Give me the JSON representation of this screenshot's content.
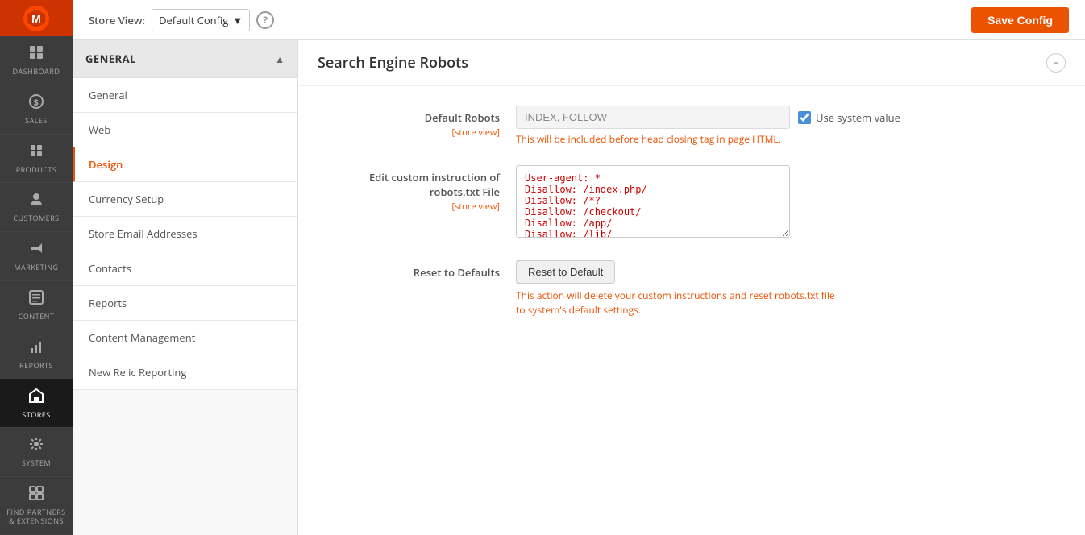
{
  "sidebar": {
    "logo_text": "M",
    "items": [
      {
        "id": "dashboard",
        "label": "DASHBOARD",
        "icon": "⊞"
      },
      {
        "id": "sales",
        "label": "SALES",
        "icon": "$"
      },
      {
        "id": "products",
        "label": "PRODUCTS",
        "icon": "◈"
      },
      {
        "id": "customers",
        "label": "CUSTOMERS",
        "icon": "👤"
      },
      {
        "id": "marketing",
        "label": "MARKETING",
        "icon": "📢"
      },
      {
        "id": "content",
        "label": "CONTENT",
        "icon": "▣"
      },
      {
        "id": "reports",
        "label": "REPORTS",
        "icon": "📊"
      },
      {
        "id": "stores",
        "label": "STORES",
        "icon": "🏪",
        "active": true
      },
      {
        "id": "system",
        "label": "SYSTEM",
        "icon": "⚙"
      },
      {
        "id": "find",
        "label": "FIND PARTNERS & EXTENSIONS",
        "icon": "🧩"
      }
    ]
  },
  "topbar": {
    "store_view_label": "Store View:",
    "store_view_value": "Default Config",
    "help_icon": "?",
    "save_button": "Save Config"
  },
  "left_nav": {
    "section_title": "GENERAL",
    "items": [
      {
        "id": "general",
        "label": "General",
        "active": false
      },
      {
        "id": "web",
        "label": "Web",
        "active": false
      },
      {
        "id": "design",
        "label": "Design",
        "active": true
      },
      {
        "id": "currency-setup",
        "label": "Currency Setup",
        "active": false
      },
      {
        "id": "store-email",
        "label": "Store Email Addresses",
        "active": false
      },
      {
        "id": "contacts",
        "label": "Contacts",
        "active": false
      },
      {
        "id": "reports",
        "label": "Reports",
        "active": false
      },
      {
        "id": "content-management",
        "label": "Content Management",
        "active": false
      },
      {
        "id": "new-relic",
        "label": "New Relic Reporting",
        "active": false
      }
    ]
  },
  "section": {
    "title": "Search Engine Robots",
    "collapse_icon": "−"
  },
  "form": {
    "default_robots": {
      "label": "Default Robots",
      "sublabel": "[store view]",
      "value": "INDEX, FOLLOW",
      "use_system_value_label": "Use system value",
      "hint": "This will be included before head closing tag in page HTML."
    },
    "custom_instructions": {
      "label": "Edit custom instruction of robots.txt File",
      "sublabel": "[store view]",
      "textarea_content": "User-agent: *\nDisallow: /index.php/\nDisallow: /*?\nDisallow: /checkout/\nDisallow: /app/\nDisallow: /lib/"
    },
    "reset": {
      "label": "Reset to Defaults",
      "button": "Reset to Default",
      "hint_part1": "This action will delete your custom instructions and reset robots.txt file to system's default settings."
    }
  }
}
